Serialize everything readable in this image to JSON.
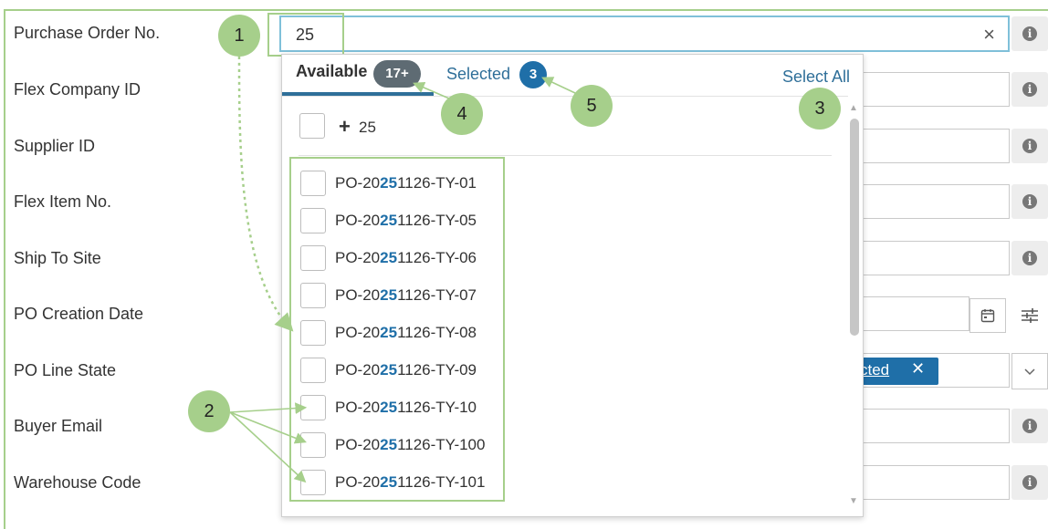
{
  "form": {
    "labels": [
      "Purchase Order No.",
      "Flex Company ID",
      "Supplier ID",
      "Flex Item No.",
      "Ship To Site",
      "PO Creation Date",
      "PO Line State",
      "Buyer Email",
      "Warehouse Code"
    ],
    "po_input_value": "25",
    "clear_symbol": "×",
    "info_symbol": "i",
    "state_chip": {
      "label": "cted",
      "remove_symbol": "✕"
    }
  },
  "dropdown": {
    "tab_available": "Available",
    "available_count": "17+",
    "tab_selected": "Selected",
    "selected_count": "3",
    "select_all": "Select All",
    "add_plus": "+",
    "add_value": "25",
    "items": [
      {
        "prefix": "PO-20",
        "match": "25",
        "suffix": "1126-TY-01"
      },
      {
        "prefix": "PO-20",
        "match": "25",
        "suffix": "1126-TY-05"
      },
      {
        "prefix": "PO-20",
        "match": "25",
        "suffix": "1126-TY-06"
      },
      {
        "prefix": "PO-20",
        "match": "25",
        "suffix": "1126-TY-07"
      },
      {
        "prefix": "PO-20",
        "match": "25",
        "suffix": "1126-TY-08"
      },
      {
        "prefix": "PO-20",
        "match": "25",
        "suffix": "1126-TY-09"
      },
      {
        "prefix": "PO-20",
        "match": "25",
        "suffix": "1126-TY-10"
      },
      {
        "prefix": "PO-20",
        "match": "25",
        "suffix": "1126-TY-100"
      },
      {
        "prefix": "PO-20",
        "match": "25",
        "suffix": "1126-TY-101"
      }
    ]
  },
  "callouts": [
    "1",
    "2",
    "3",
    "4",
    "5"
  ],
  "colors": {
    "accent": "#1f6fa8",
    "annotation": "#a6cf8b",
    "badge_grey": "#5e6b73",
    "input_focus": "#7fc0d9"
  },
  "icons": [
    "clear-icon",
    "info-icon",
    "calendar-icon",
    "filter-icon",
    "chevron-down-icon",
    "chip-remove-icon",
    "plus-icon"
  ]
}
